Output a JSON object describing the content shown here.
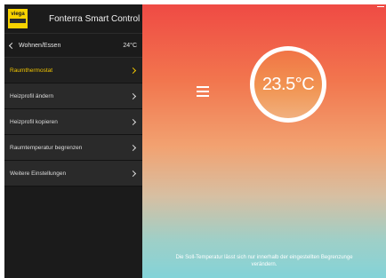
{
  "brand": {
    "logo_text": "viega",
    "title": "Fonterra Smart Control"
  },
  "breadcrumb": {
    "label": "Wohnen/Essen",
    "temperature": "24°C"
  },
  "menu": {
    "items": [
      {
        "label": "Raumthermostat"
      },
      {
        "label": "Heizprofil ändern"
      },
      {
        "label": "Heizprofil kopieren"
      },
      {
        "label": "Raumtemperatur begrenzen"
      },
      {
        "label": "Weitere Einstellungen"
      }
    ]
  },
  "thermostat": {
    "temperature": "23.5°C"
  },
  "info": {
    "line1": "Die Soll-Temperatur lässt sich nur innerhalb der eingestellten Begrenzunge",
    "line2": "verändern."
  },
  "colors": {
    "active": "#f0c400",
    "accent_logo": "#f7d200",
    "gradient_top": "#ef4a44",
    "gradient_bottom": "#83d3d8"
  },
  "icons": [
    "chevron-left-icon",
    "chevron-right-icon",
    "hamburger-menu-icon"
  ]
}
